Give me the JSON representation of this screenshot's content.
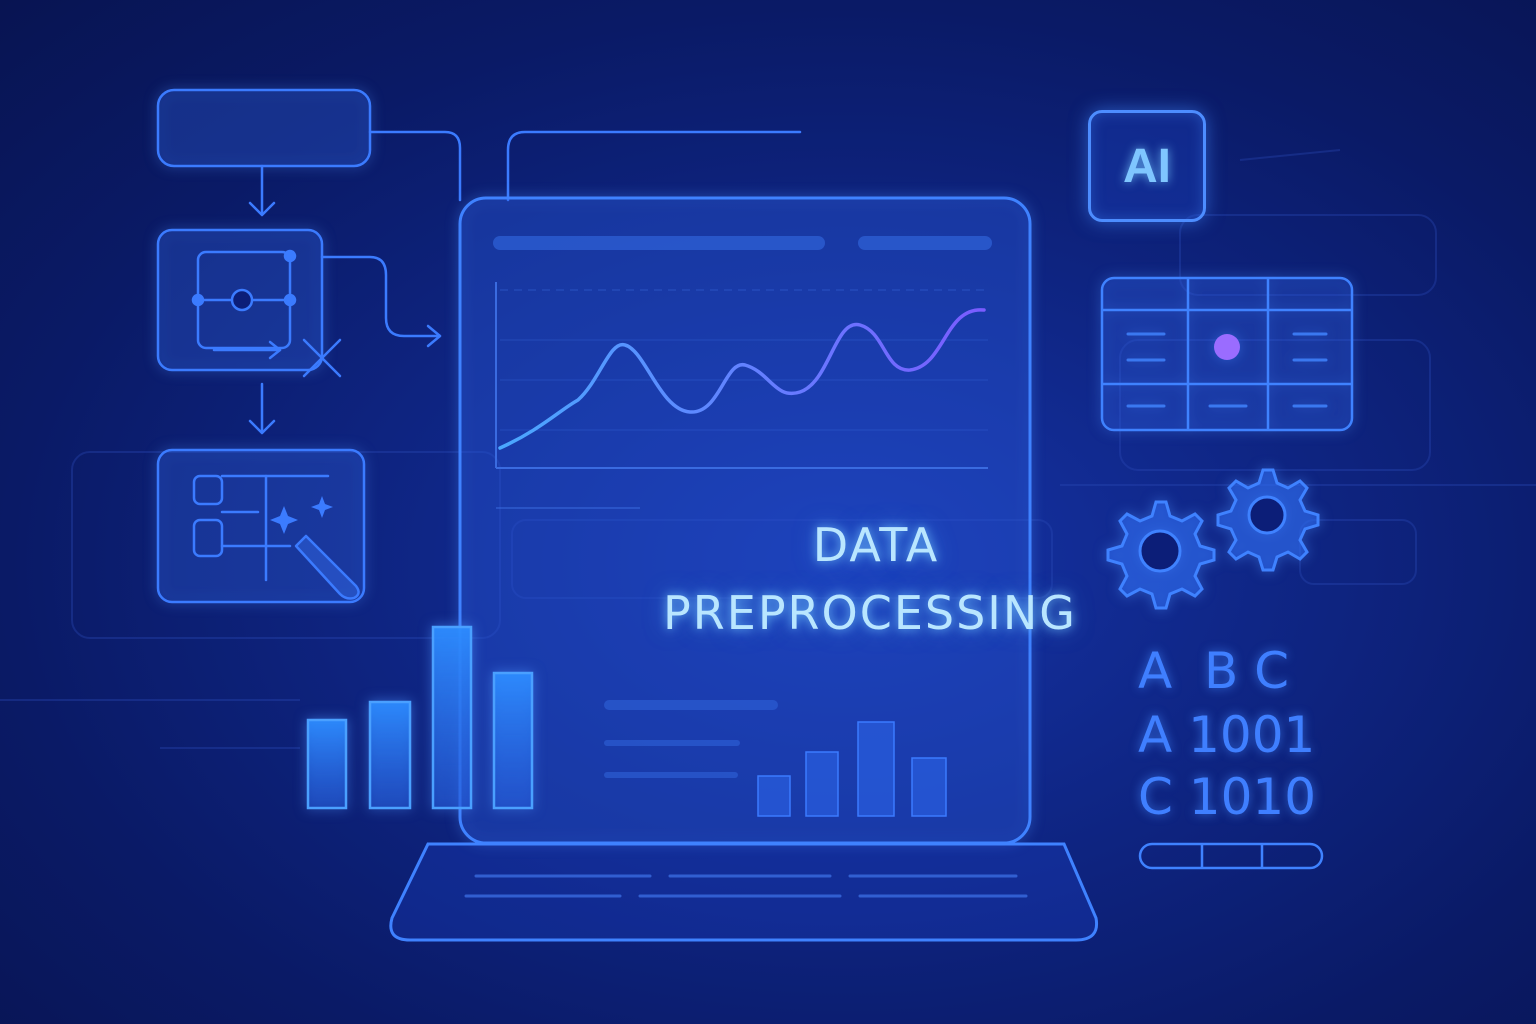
{
  "title": {
    "line1": "DATA",
    "line2": "PREPROCESSING"
  },
  "badge": {
    "label": "AI"
  },
  "code_lines": [
    "A  B C",
    "A 1001",
    "C 1010"
  ],
  "icons": [
    "flowchart-icon",
    "line-chart-icon",
    "bar-chart-icon",
    "data-table-icon",
    "gear-icon",
    "laptop-icon",
    "magic-wand-icon"
  ],
  "colors": {
    "background": "#0c1e78",
    "accent": "#4d8dff",
    "line_purple": "#7a5cff",
    "title": "#b9e6ff"
  }
}
